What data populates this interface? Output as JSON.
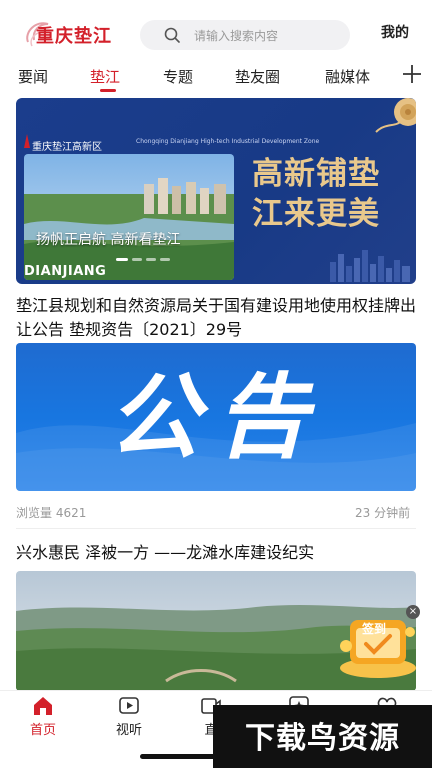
{
  "header": {
    "logo_text": "重庆垫江",
    "search_placeholder": "请输入搜索内容",
    "mine_label": "我的"
  },
  "tabs": [
    {
      "label": "要闻"
    },
    {
      "label": "垫江"
    },
    {
      "label": "专题"
    },
    {
      "label": "垫友圈"
    },
    {
      "label": "融媒体"
    }
  ],
  "active_tab": "垫江",
  "banner": {
    "zone_title": "重庆垫江高新区",
    "zone_subtitle": "Chongqing Dianjiang High-tech Industrial Development Zone",
    "headline_line1": "高新铺垫",
    "headline_line2": "江来更美",
    "caption": "扬帆正启航 高新看垫江",
    "brand": "DIANJIANG",
    "slide_count": 5,
    "active_slide": 1
  },
  "articles": [
    {
      "title": "垫江县规划和自然资源局关于国有建设用地使用权挂牌出让公告 垫规资告〔2021〕29号",
      "image_text": "公告",
      "views": "浏览量 4621",
      "time": "23 分钟前"
    },
    {
      "title": "兴水惠民 泽被一方 ——龙滩水库建设纪实"
    }
  ],
  "signin_badge": {
    "label": "签到",
    "close": "×"
  },
  "bottom_nav": [
    {
      "label": "首页",
      "icon": "home-icon"
    },
    {
      "label": "视听",
      "icon": "play-icon"
    },
    {
      "label": "直",
      "icon": "live-icon"
    },
    {
      "label": "",
      "icon": "star-icon"
    },
    {
      "label": "",
      "icon": "heart-icon"
    }
  ],
  "watermark": "下载鸟资源",
  "colors": {
    "accent": "#d3202a",
    "banner_blue": "#1b3d8c",
    "gold": "#e9c88c",
    "notice_blue": "#1876e0"
  }
}
